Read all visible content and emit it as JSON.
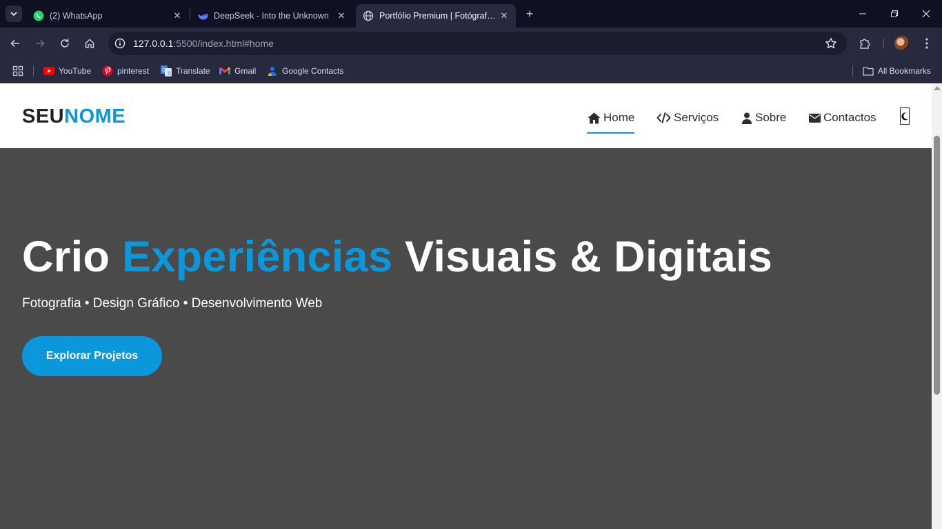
{
  "browser": {
    "tabs": [
      {
        "title": "(2) WhatsApp",
        "icon": "whatsapp-icon"
      },
      {
        "title": "DeepSeek - Into the Unknown",
        "icon": "deepseek-icon"
      },
      {
        "title": "Portfólio Premium | Fotógrafo, Designer & Dev",
        "icon": "globe-icon",
        "active": true
      }
    ],
    "url_host": "127.0.0.1",
    "url_rest": ":5500/index.html#home",
    "bookmarks": [
      {
        "label": "YouTube",
        "icon": "youtube-icon"
      },
      {
        "label": "pinterest",
        "icon": "pinterest-icon"
      },
      {
        "label": "Translate",
        "icon": "translate-icon"
      },
      {
        "label": "Gmail",
        "icon": "gmail-icon"
      },
      {
        "label": "Google Contacts",
        "icon": "contacts-icon"
      }
    ],
    "all_bookmarks": "All Bookmarks"
  },
  "site": {
    "logo": {
      "first": "SEU",
      "second": "NOME"
    },
    "nav": [
      {
        "label": "Home",
        "icon": "home-icon",
        "active": true
      },
      {
        "label": "Serviços",
        "icon": "code-icon"
      },
      {
        "label": "Sobre",
        "icon": "user-icon"
      },
      {
        "label": "Contactos",
        "icon": "envelope-icon"
      }
    ],
    "theme_toggle_icon": "moon-icon"
  },
  "hero": {
    "title_start": "Crio ",
    "title_accent": "Experiências",
    "title_end": " Visuais & Digitais",
    "subtitle": "Fotografia • Design Gráfico • Desenvolvimento Web",
    "cta": "Explorar Projetos"
  },
  "colors": {
    "accent": "#0a97dc",
    "hero_bg": "#4a4a4a",
    "chrome_dark": "#0f1021",
    "chrome_toolbar": "#272a3f"
  }
}
